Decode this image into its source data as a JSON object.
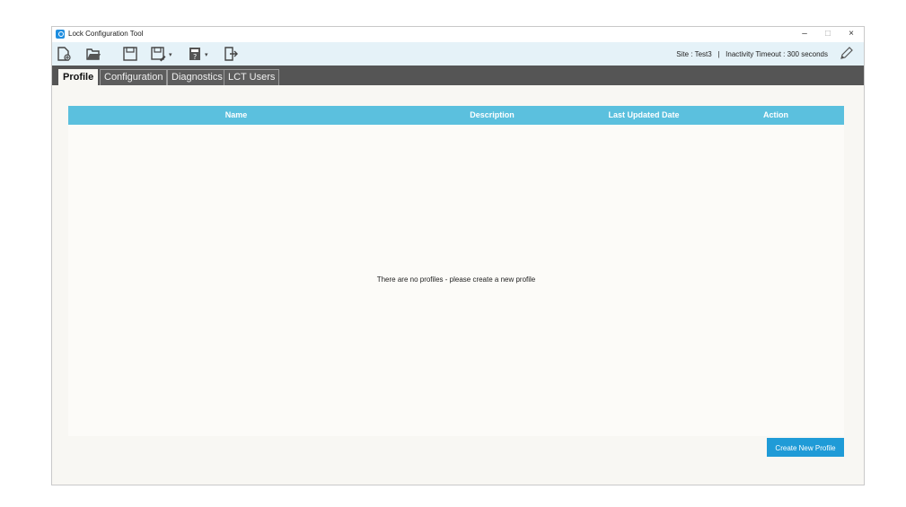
{
  "window": {
    "title": "Lock Configuration Tool"
  },
  "controls": {
    "minimize": "–",
    "maximize": "□",
    "close": "×"
  },
  "toolbar": {
    "icons": [
      "new-file-icon",
      "open-folder-icon",
      "save-icon",
      "save-as-icon",
      "calculator-icon",
      "exit-icon"
    ],
    "site_label": "Site :",
    "site_value": "Test3",
    "separator": "|",
    "timeout_label": "Inactivity Timeout :",
    "timeout_value": "300 seconds"
  },
  "tabs": [
    {
      "label": "Profile",
      "active": true
    },
    {
      "label": "Configuration",
      "active": false
    },
    {
      "label": "Diagnostics",
      "active": false
    },
    {
      "label": "LCT Users",
      "active": false
    }
  ],
  "table": {
    "columns": [
      "Name",
      "Description",
      "Last Updated Date",
      "Action"
    ],
    "rows": [],
    "empty_message": "There are no profiles - please create a new profile"
  },
  "actions": {
    "create_profile": "Create New Profile"
  },
  "colors": {
    "accent": "#5bc0de",
    "button": "#1f9bd7",
    "tabbar": "#555555",
    "toolbar": "#e5f2f8"
  }
}
